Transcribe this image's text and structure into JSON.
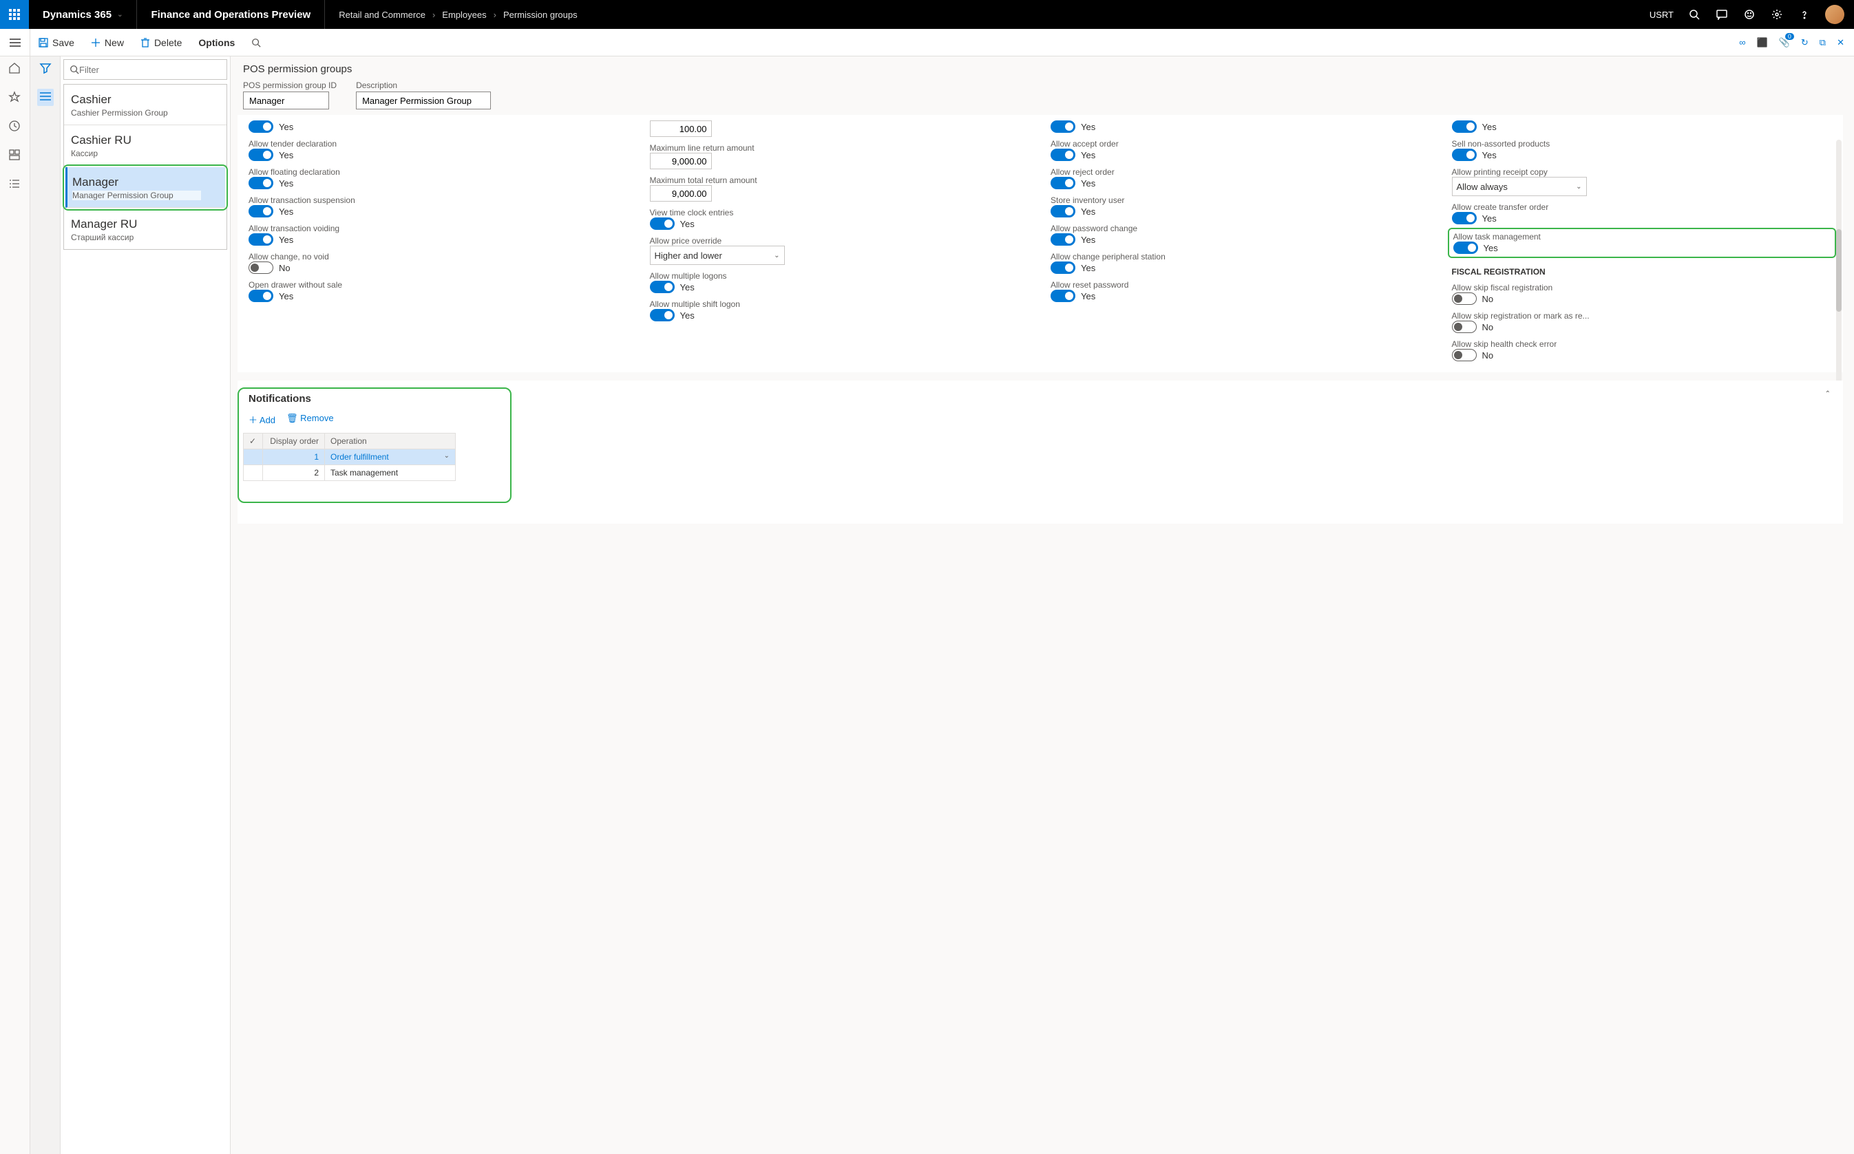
{
  "header": {
    "app_name": "Dynamics 365",
    "preview": "Finance and Operations Preview",
    "crumbs": [
      "Retail and Commerce",
      "Employees",
      "Permission groups"
    ],
    "org": "USRT"
  },
  "cmdbar": {
    "save": "Save",
    "new": "New",
    "delete": "Delete",
    "options": "Options"
  },
  "filter_placeholder": "Filter",
  "list": [
    {
      "title": "Cashier",
      "sub": "Cashier Permission Group",
      "selected": false
    },
    {
      "title": "Cashier RU",
      "sub": "Кассир",
      "selected": false
    },
    {
      "title": "Manager",
      "sub": "Manager Permission Group",
      "selected": true
    },
    {
      "title": "Manager RU",
      "sub": "Старший кассир",
      "selected": false
    }
  ],
  "page_title": "POS permission groups",
  "form_header": {
    "id_label": "POS permission group ID",
    "id_value": "Manager",
    "desc_label": "Description",
    "desc_value": "Manager Permission Group"
  },
  "perms": {
    "col1": [
      {
        "type": "toggle_cut",
        "on": true,
        "val": "Yes"
      },
      {
        "type": "toggle",
        "label": "Allow tender declaration",
        "on": true,
        "val": "Yes"
      },
      {
        "type": "toggle",
        "label": "Allow floating declaration",
        "on": true,
        "val": "Yes"
      },
      {
        "type": "toggle",
        "label": "Allow transaction suspension",
        "on": true,
        "val": "Yes"
      },
      {
        "type": "toggle",
        "label": "Allow transaction voiding",
        "on": true,
        "val": "Yes"
      },
      {
        "type": "toggle",
        "label": "Allow change, no void",
        "on": false,
        "val": "No"
      },
      {
        "type": "toggle",
        "label": "Open drawer without sale",
        "on": true,
        "val": "Yes"
      }
    ],
    "col2": [
      {
        "type": "number_cut",
        "val": "100.00"
      },
      {
        "type": "number",
        "label": "Maximum line return amount",
        "val": "9,000.00"
      },
      {
        "type": "number",
        "label": "Maximum total return amount",
        "val": "9,000.00"
      },
      {
        "type": "toggle",
        "label": "View time clock entries",
        "on": true,
        "val": "Yes"
      },
      {
        "type": "select",
        "label": "Allow price override",
        "val": "Higher and lower"
      },
      {
        "type": "toggle",
        "label": "Allow multiple logons",
        "on": true,
        "val": "Yes"
      },
      {
        "type": "toggle",
        "label": "Allow multiple shift logon",
        "on": true,
        "val": "Yes"
      }
    ],
    "col3": [
      {
        "type": "toggle_cut",
        "on": true,
        "val": "Yes"
      },
      {
        "type": "toggle",
        "label": "Allow accept order",
        "on": true,
        "val": "Yes"
      },
      {
        "type": "toggle",
        "label": "Allow reject order",
        "on": true,
        "val": "Yes"
      },
      {
        "type": "toggle",
        "label": "Store inventory user",
        "on": true,
        "val": "Yes"
      },
      {
        "type": "toggle",
        "label": "Allow password change",
        "on": true,
        "val": "Yes"
      },
      {
        "type": "toggle",
        "label": "Allow change peripheral station",
        "on": true,
        "val": "Yes"
      },
      {
        "type": "toggle",
        "label": "Allow reset password",
        "on": true,
        "val": "Yes"
      }
    ],
    "col4": [
      {
        "type": "toggle_cut",
        "on": true,
        "val": "Yes"
      },
      {
        "type": "toggle",
        "label": "Sell non-assorted products",
        "on": true,
        "val": "Yes"
      },
      {
        "type": "select",
        "label": "Allow printing receipt copy",
        "val": "Allow always"
      },
      {
        "type": "toggle",
        "label": "Allow create transfer order",
        "on": true,
        "val": "Yes"
      },
      {
        "type": "toggle",
        "label": "Allow task management",
        "on": true,
        "val": "Yes",
        "highlight": true
      },
      {
        "type": "section",
        "label": "FISCAL REGISTRATION"
      },
      {
        "type": "toggle",
        "label": "Allow skip fiscal registration",
        "on": false,
        "val": "No"
      },
      {
        "type": "toggle",
        "label": "Allow skip registration or mark as re...",
        "on": false,
        "val": "No"
      },
      {
        "type": "toggle",
        "label": "Allow skip health check error",
        "on": false,
        "val": "No"
      }
    ]
  },
  "notifications": {
    "title": "Notifications",
    "add": "Add",
    "remove": "Remove",
    "cols": {
      "check": "✓",
      "disp": "Display order",
      "op": "Operation"
    },
    "rows": [
      {
        "order": "1",
        "op": "Order fulfillment",
        "sel": true
      },
      {
        "order": "2",
        "op": "Task management",
        "sel": false
      }
    ]
  }
}
